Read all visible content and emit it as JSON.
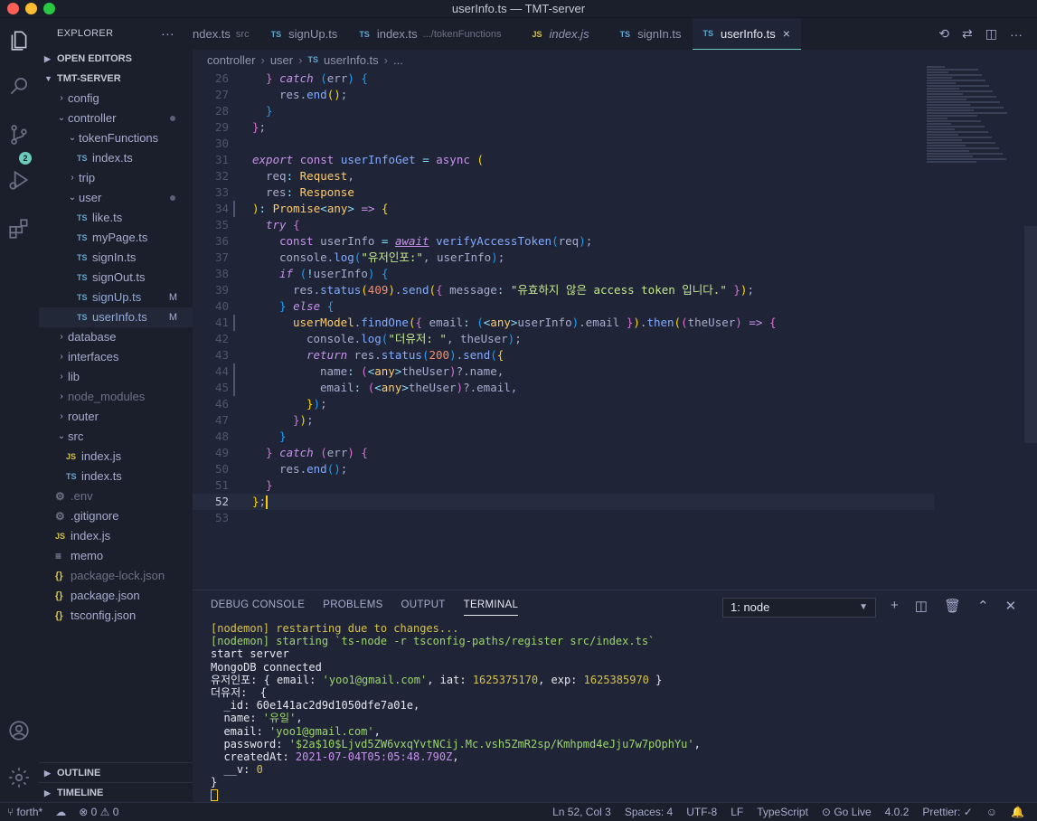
{
  "window": {
    "title": "userInfo.ts — TMT-server"
  },
  "activity": {
    "scm_badge": "2"
  },
  "sidebar": {
    "header": "EXPLORER",
    "more": "···",
    "open_editors": "OPEN EDITORS",
    "project": "TMT-SERVER",
    "outline": "OUTLINE",
    "timeline": "TIMELINE",
    "tree": [
      {
        "label": "config",
        "kind": "folder",
        "depth": 1,
        "open": false
      },
      {
        "label": "controller",
        "kind": "folder",
        "depth": 1,
        "open": true,
        "dot": true
      },
      {
        "label": "tokenFunctions",
        "kind": "folder",
        "depth": 2,
        "open": true
      },
      {
        "label": "index.ts",
        "kind": "ts",
        "depth": 3
      },
      {
        "label": "trip",
        "kind": "folder",
        "depth": 2,
        "open": false
      },
      {
        "label": "user",
        "kind": "folder",
        "depth": 2,
        "open": true,
        "dot": true
      },
      {
        "label": "like.ts",
        "kind": "ts",
        "depth": 3
      },
      {
        "label": "myPage.ts",
        "kind": "ts",
        "depth": 3
      },
      {
        "label": "signIn.ts",
        "kind": "ts",
        "depth": 3
      },
      {
        "label": "signOut.ts",
        "kind": "ts",
        "depth": 3
      },
      {
        "label": "signUp.ts",
        "kind": "ts",
        "depth": 3,
        "mod": "M"
      },
      {
        "label": "userInfo.ts",
        "kind": "ts",
        "depth": 3,
        "mod": "M",
        "selected": true
      },
      {
        "label": "database",
        "kind": "folder",
        "depth": 1,
        "open": false
      },
      {
        "label": "interfaces",
        "kind": "folder",
        "depth": 1,
        "open": false
      },
      {
        "label": "lib",
        "kind": "folder",
        "depth": 1,
        "open": false
      },
      {
        "label": "node_modules",
        "kind": "folder",
        "depth": 1,
        "open": false,
        "dim": true
      },
      {
        "label": "router",
        "kind": "folder",
        "depth": 1,
        "open": false
      },
      {
        "label": "src",
        "kind": "folder",
        "depth": 1,
        "open": true
      },
      {
        "label": "index.js",
        "kind": "js",
        "depth": 2
      },
      {
        "label": "index.ts",
        "kind": "ts",
        "depth": 2
      },
      {
        "label": ".env",
        "kind": "gear",
        "depth": 1,
        "dim": true
      },
      {
        "label": ".gitignore",
        "kind": "gear",
        "depth": 1
      },
      {
        "label": "index.js",
        "kind": "js",
        "depth": 1
      },
      {
        "label": "memo",
        "kind": "memo",
        "depth": 1
      },
      {
        "label": "package-lock.json",
        "kind": "json",
        "depth": 1,
        "dim": true
      },
      {
        "label": "package.json",
        "kind": "json",
        "depth": 1
      },
      {
        "label": "tsconfig.json",
        "kind": "json",
        "depth": 1
      }
    ]
  },
  "tabs": [
    {
      "icon": "",
      "label": "ndex.ts",
      "desc": "src"
    },
    {
      "icon": "TS",
      "label": "signUp.ts",
      "desc": ""
    },
    {
      "icon": "TS",
      "label": "index.ts",
      "desc": ".../tokenFunctions"
    },
    {
      "icon": "JS",
      "label": "index.js",
      "desc": "",
      "italic": true
    },
    {
      "icon": "TS",
      "label": "signIn.ts",
      "desc": ""
    },
    {
      "icon": "TS",
      "label": "userInfo.ts",
      "desc": "",
      "active": true
    }
  ],
  "breadcrumb": [
    "controller",
    "user",
    "userInfo.ts",
    "..."
  ],
  "code": {
    "current_line": 52,
    "lines": [
      {
        "n": 26,
        "indent": 1,
        "html": "<span class=\"br2\">}</span> <span class=\"k\">catch</span> <span class=\"br3\">(</span>err<span class=\"br3\">)</span> <span class=\"br3\">{</span>"
      },
      {
        "n": 27,
        "indent": 2,
        "html": "res.<span class=\"f\">end</span><span class=\"br1\">()</span>;"
      },
      {
        "n": 28,
        "indent": 1,
        "html": "<span class=\"br3\">}</span>"
      },
      {
        "n": 29,
        "indent": 0,
        "html": "<span class=\"br2\">}</span>;"
      },
      {
        "n": 30,
        "indent": 0,
        "html": ""
      },
      {
        "n": 31,
        "indent": 0,
        "html": "<span class=\"k\">export</span> <span class=\"kn\">const</span> <span class=\"f\">userInfoGet</span> <span class=\"p\">=</span> <span class=\"kn\">async</span> <span class=\"br1\">(</span>"
      },
      {
        "n": 32,
        "indent": 1,
        "html": "req<span class=\"p\">:</span> <span class=\"ty\">Request</span>,"
      },
      {
        "n": 33,
        "indent": 1,
        "html": "res<span class=\"p\">:</span> <span class=\"ty\">Response</span>"
      },
      {
        "n": 34,
        "indent": 0,
        "html": "<span class=\"br1\">)</span><span class=\"p\">:</span> <span class=\"ty\">Promise</span><span class=\"p\">&lt;</span><span class=\"ty\">any</span><span class=\"p\">&gt;</span> <span class=\"kn\">=&gt;</span> <span class=\"br1\">{</span>"
      },
      {
        "n": 35,
        "indent": 1,
        "html": "<span class=\"k\">try</span> <span class=\"br2\">{</span>"
      },
      {
        "n": 36,
        "indent": 2,
        "html": "<span class=\"kn\">const</span> userInfo <span class=\"p\">=</span> <span class=\"k\" style=\"text-decoration:underline\">await</span> <span class=\"f\">verifyAccessToken</span><span class=\"br3\">(</span>req<span class=\"br3\">)</span>;"
      },
      {
        "n": 37,
        "indent": 2,
        "html": "console.<span class=\"f\">log</span><span class=\"br3\">(</span><span class=\"s\">\"유저인포:\"</span>, userInfo<span class=\"br3\">)</span>;"
      },
      {
        "n": 38,
        "indent": 2,
        "html": "<span class=\"k\">if</span> <span class=\"br3\">(</span><span class=\"p\">!</span>userInfo<span class=\"br3\">)</span> <span class=\"br3\">{</span>"
      },
      {
        "n": 39,
        "indent": 3,
        "html": "res.<span class=\"f\">status</span><span class=\"br1\">(</span><span class=\"n\">409</span><span class=\"br1\">)</span>.<span class=\"f\">send</span><span class=\"br1\">(</span><span class=\"br2\">{</span> message<span class=\"p\">:</span> <span class=\"s\">\"유효하지 않은 access token 입니다.\"</span> <span class=\"br2\">}</span><span class=\"br1\">)</span>;"
      },
      {
        "n": 40,
        "indent": 2,
        "html": "<span class=\"br3\">}</span> <span class=\"k\">else</span> <span class=\"br3\">{</span>"
      },
      {
        "n": 41,
        "indent": 3,
        "html": "<span class=\"ty\">userModel</span>.<span class=\"f\">findOne</span><span class=\"br1\">(</span><span class=\"br2\">{</span> email<span class=\"p\">:</span> <span class=\"br3\">(</span><span class=\"p\">&lt;</span><span class=\"ty\">any</span><span class=\"p\">&gt;</span>userInfo<span class=\"br3\">)</span>.email <span class=\"br2\">}</span><span class=\"br1\">)</span>.<span class=\"f\">then</span><span class=\"br1\">(</span><span class=\"br2\">(</span>theUser<span class=\"br2\">)</span> <span class=\"kn\">=&gt;</span> <span class=\"br2\">{</span>"
      },
      {
        "n": 42,
        "indent": 4,
        "html": "console.<span class=\"f\">log</span><span class=\"br3\">(</span><span class=\"s\">\"더유저: \"</span>, theUser<span class=\"br3\">)</span>;"
      },
      {
        "n": 43,
        "indent": 4,
        "html": "<span class=\"k\">return</span> res.<span class=\"f\">status</span><span class=\"br3\">(</span><span class=\"n\">200</span><span class=\"br3\">)</span>.<span class=\"f\">send</span><span class=\"br3\">(</span><span class=\"br1\">{</span>"
      },
      {
        "n": 44,
        "indent": 5,
        "html": "name<span class=\"p\">:</span> <span class=\"br2\">(</span><span class=\"p\">&lt;</span><span class=\"ty\">any</span><span class=\"p\">&gt;</span>theUser<span class=\"br2\">)</span>?.name,"
      },
      {
        "n": 45,
        "indent": 5,
        "html": "email<span class=\"p\">:</span> <span class=\"br2\">(</span><span class=\"p\">&lt;</span><span class=\"ty\">any</span><span class=\"p\">&gt;</span>theUser<span class=\"br2\">)</span>?.email,"
      },
      {
        "n": 46,
        "indent": 4,
        "html": "<span class=\"br1\">}</span><span class=\"br3\">)</span>;"
      },
      {
        "n": 47,
        "indent": 3,
        "html": "<span class=\"br2\">}</span><span class=\"br1\">)</span>;"
      },
      {
        "n": 48,
        "indent": 2,
        "html": "<span class=\"br3\">}</span>"
      },
      {
        "n": 49,
        "indent": 1,
        "html": "<span class=\"br2\">}</span> <span class=\"k\">catch</span> <span class=\"br2\">(</span>err<span class=\"br2\">)</span> <span class=\"br2\">{</span>"
      },
      {
        "n": 50,
        "indent": 2,
        "html": "res.<span class=\"f\">end</span><span class=\"br3\">()</span>;"
      },
      {
        "n": 51,
        "indent": 1,
        "html": "<span class=\"br2\">}</span>"
      },
      {
        "n": 52,
        "indent": 0,
        "html": "<span class=\"br1\">}</span>;<span class=\"cursor\"></span>"
      },
      {
        "n": 53,
        "indent": 0,
        "html": ""
      }
    ]
  },
  "panel": {
    "tabs": [
      "DEBUG CONSOLE",
      "PROBLEMS",
      "OUTPUT",
      "TERMINAL"
    ],
    "active_tab": "TERMINAL",
    "terminal_select": "1: node",
    "terminal_lines": [
      {
        "html": "<span class=\"t-y\">[nodemon] restarting due to changes...</span>"
      },
      {
        "html": "<span class=\"t-g\">[nodemon] starting `ts-node -r tsconfig-paths/register src/index.ts`</span>"
      },
      {
        "html": "start server"
      },
      {
        "html": "MongoDB connected"
      },
      {
        "html": "유저인포: { email: <span class=\"t-g\">'yoo1@gmail.com'</span>, iat: <span class=\"t-n\">1625375170</span>, exp: <span class=\"t-n\">1625385970</span> }"
      },
      {
        "html": "더유저:  {"
      },
      {
        "html": "  _id: 60e141ac2d9d1050dfe7a01e,"
      },
      {
        "html": "  name: <span class=\"t-g\">'유일'</span>,"
      },
      {
        "html": "  email: <span class=\"t-g\">'yoo1@gmail.com'</span>,"
      },
      {
        "html": "  password: <span class=\"t-g\">'$2a$10$Ljvd5ZW6vxqYvtNCij.Mc.vsh5ZmR2sp/Kmhpmd4eJju7w7pOphYu'</span>,"
      },
      {
        "html": "  createdAt: <span class=\"t-p\">2021-07-04T05:05:48.790Z</span>,"
      },
      {
        "html": "  __v: <span class=\"t-n\">0</span>"
      },
      {
        "html": "}"
      },
      {
        "html": "<span class=\"t-cursor\"></span>"
      }
    ]
  },
  "status": {
    "branch": "forth*",
    "errors": "0",
    "warnings": "0",
    "position": "Ln 52, Col 3",
    "spaces": "Spaces: 4",
    "encoding": "UTF-8",
    "eol": "LF",
    "language": "TypeScript",
    "golive": "Go Live",
    "version": "4.0.2",
    "prettier": "Prettier: ✓"
  },
  "colors": {
    "accent": "#6acdbb",
    "background": "#1f2536",
    "sidebar": "#1b1f2c"
  }
}
